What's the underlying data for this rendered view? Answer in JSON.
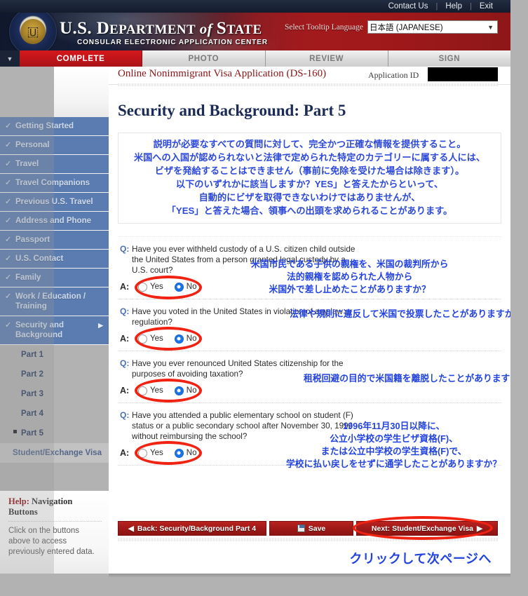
{
  "utility": {
    "links": [
      "Contact Us",
      "Help",
      "Exit"
    ],
    "separator": "|"
  },
  "banner": {
    "seal_icon": "us-department-of-state-seal-icon",
    "title_prefix": "U.S. D",
    "title_epartment": "EPARTMENT",
    "title_of": " of ",
    "title_s": "S",
    "title_tate": "TATE",
    "subtitle": "CONSULAR ELECTRONIC APPLICATION CENTER",
    "language_label": "Select Tooltip Language",
    "language_value": "日本語 (JAPANESE)",
    "caret_icon": "chevron-down-icon"
  },
  "stages": [
    {
      "label": "COMPLETE",
      "active": true
    },
    {
      "label": "PHOTO",
      "active": false
    },
    {
      "label": "REVIEW",
      "active": false
    },
    {
      "label": "SIGN",
      "active": false
    }
  ],
  "sidebar": {
    "items": [
      {
        "label": "Getting Started",
        "complete": true,
        "expanded": false
      },
      {
        "label": "Personal",
        "complete": true,
        "expanded": false
      },
      {
        "label": "Travel",
        "complete": true,
        "expanded": false
      },
      {
        "label": "Travel Companions",
        "complete": true,
        "expanded": false
      },
      {
        "label": "Previous U.S. Travel",
        "complete": true,
        "expanded": false
      },
      {
        "label": "Address and Phone",
        "complete": true,
        "expanded": false
      },
      {
        "label": "Passport",
        "complete": true,
        "expanded": false
      },
      {
        "label": "U.S. Contact",
        "complete": true,
        "expanded": false
      },
      {
        "label": "Family",
        "complete": true,
        "expanded": false
      },
      {
        "label": "Work / Education / Training",
        "complete": true,
        "expanded": false
      },
      {
        "label": "Security and Background",
        "complete": true,
        "expanded": true
      }
    ],
    "check_icon": "check-icon",
    "arrow_icon": "triangle-right-icon",
    "subitems": [
      {
        "label": "Part 1",
        "current": false,
        "future": false
      },
      {
        "label": "Part 2",
        "current": false,
        "future": false
      },
      {
        "label": "Part 3",
        "current": false,
        "future": false
      },
      {
        "label": "Part 4",
        "current": false,
        "future": false
      },
      {
        "label": "Part 5",
        "current": true,
        "future": false
      },
      {
        "label": "Student/Exchange Visa",
        "current": false,
        "future": true
      }
    ]
  },
  "help": {
    "title_prefix": "Help:",
    "title": " Navigation Buttons",
    "body": "Click on the buttons above to access previously entered data."
  },
  "appbar": {
    "app_title": "Online Nonimmigrant Visa Application (DS-160)",
    "app_id_label": "Application ID",
    "app_id_value": ""
  },
  "page": {
    "title": "Security and Background: Part 5"
  },
  "instruction": {
    "lines": [
      "説明が必要なすべての質問に対して、完全かつ正確な情報を提供すること。",
      "米国への入国が認められないと法律で定められた特定のカテゴリーに属する人には、",
      "ビザを発給することはできません（事前に免除を受けた場合は除きます）。",
      "以下のいずれかに該当しますか？YES」と答えたからといって、",
      "自動的にビザを取得できないわけではありませんが、",
      "「YES」と答えた場合、領事への出頭を求められることがあります。"
    ]
  },
  "question_marker": "Q:",
  "answer_marker": "A:",
  "questions": [
    {
      "text": "Have you ever withheld custody of a U.S. citizen child outside the United States from a person granted legal custody by a U.S. court?",
      "options": [
        {
          "label": "Yes",
          "checked": false
        },
        {
          "label": "No",
          "checked": true
        }
      ],
      "annotation_lines": [
        "米国市民である子供の親権を、米国の裁判所から",
        "法的親権を認められた人物から",
        "米国外で差し止めたことがありますか？"
      ]
    },
    {
      "text": "Have you voted in the United States in violation of any law or regulation?",
      "options": [
        {
          "label": "Yes",
          "checked": false
        },
        {
          "label": "No",
          "checked": true
        }
      ],
      "annotation_lines": [
        "法律や規則に違反して米国で投票したことがありますか？"
      ]
    },
    {
      "text": "Have you ever renounced United States citizenship for the purposes of avoiding taxation?",
      "options": [
        {
          "label": "Yes",
          "checked": false
        },
        {
          "label": "No",
          "checked": true
        }
      ],
      "annotation_lines": [
        "租税回避の目的で米国籍を離脱したことがありますか？"
      ]
    },
    {
      "text": "Have you attended a public elementary school on student (F) status or a public secondary school after November 30, 1996 without reimbursing the school?",
      "options": [
        {
          "label": "Yes",
          "checked": false
        },
        {
          "label": "No",
          "checked": true
        }
      ],
      "annotation_lines": [
        "1996年11月30日以降に、",
        "公立小学校の学生ビザ資格(F)、",
        "または公立中学校の学生資格(F)で、",
        "学校に払い戻しをせずに通学したことがありますか？"
      ]
    }
  ],
  "footer": {
    "back_label": "Back: Security/Background Part 4",
    "back_icon": "triangle-left-icon",
    "save_label": "Save",
    "save_icon": "floppy-disk-icon",
    "next_label": "Next: Student/Exchange Visa",
    "next_icon": "triangle-right-icon",
    "annotation": "クリックして次ページへ"
  },
  "colors": {
    "accent_red": "#a81317",
    "nav_blue": "#5a7cb0",
    "title_navy": "#1b2b56",
    "annotation_blue": "#2243e0",
    "circle_red": "#f02211",
    "radio_selected": "#1a73e8"
  }
}
